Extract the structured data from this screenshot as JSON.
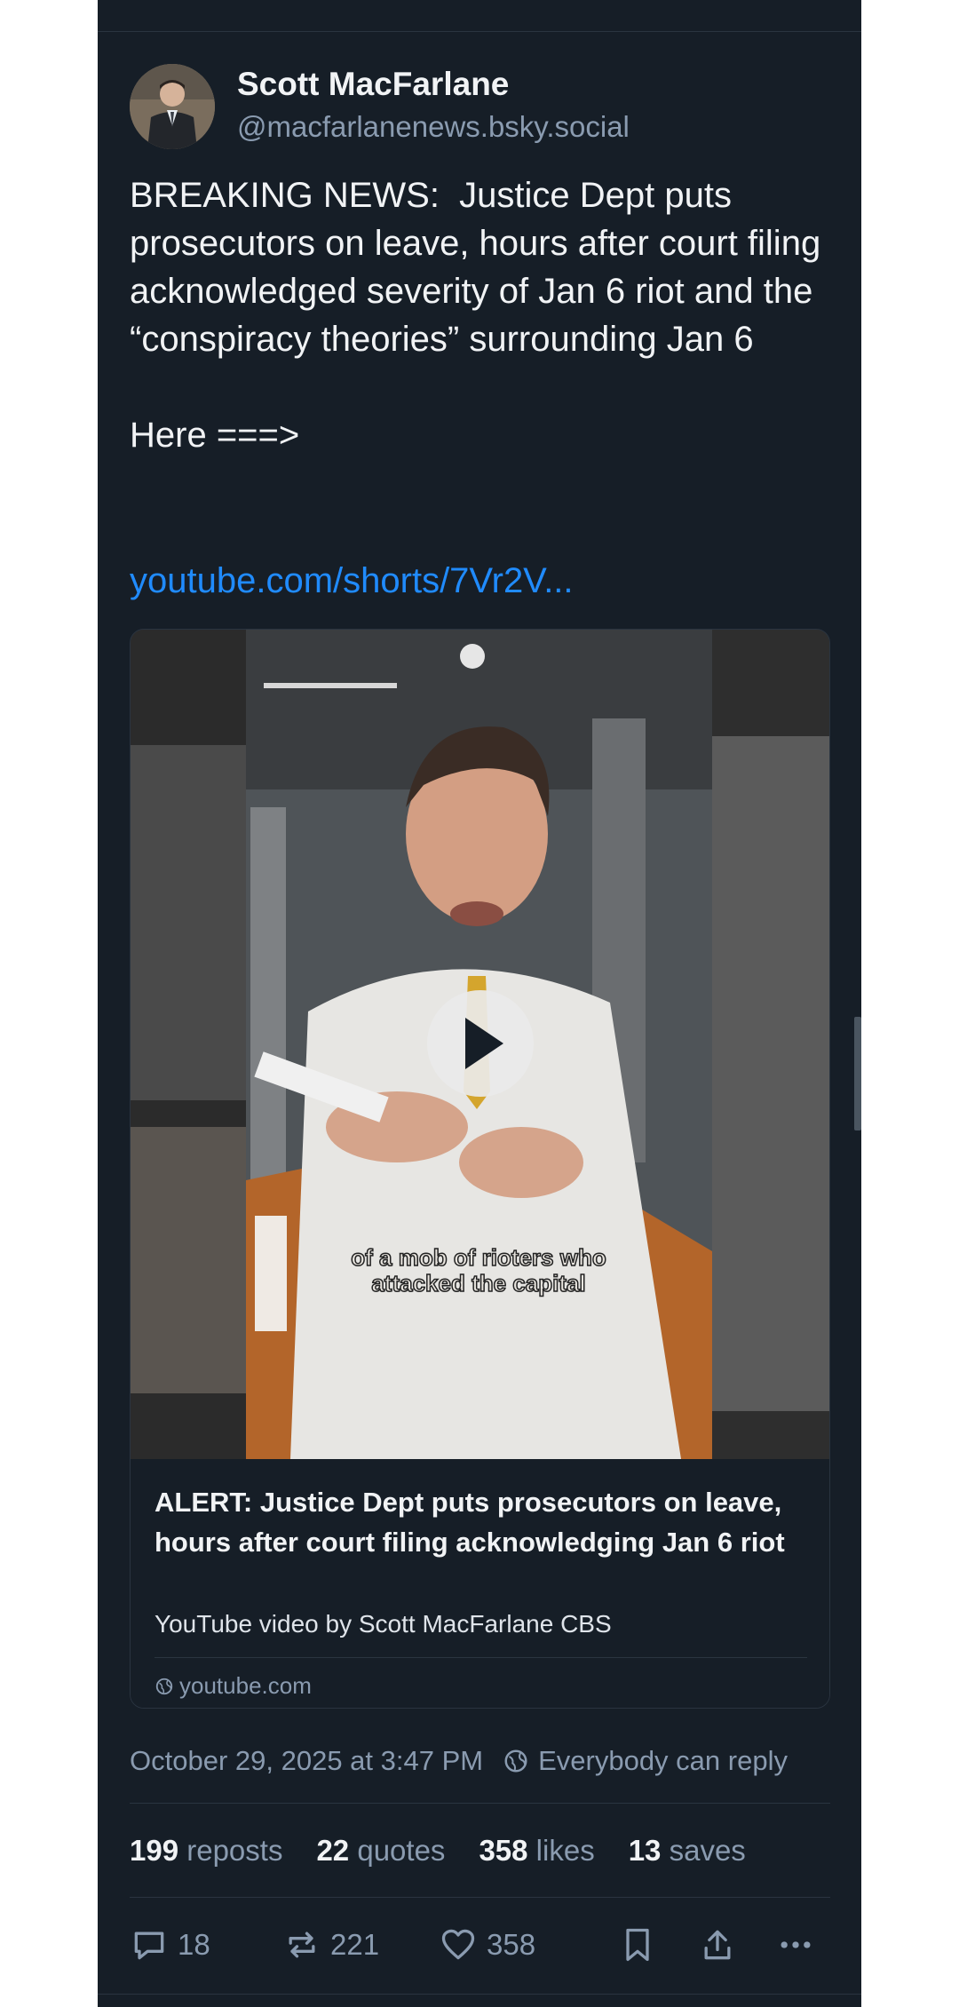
{
  "author": {
    "name": "Scott MacFarlane",
    "handle": "@macfarlanenews.bsky.social"
  },
  "post": {
    "text": "BREAKING NEWS:  Justice Dept puts prosecutors on leave, hours after court filing acknowledged severity of Jan 6 riot and the “conspiracy theories” surrounding Jan 6\n\nHere ===>",
    "link": "youtube.com/shorts/7Vr2V..."
  },
  "embed": {
    "caption_line1": "of a mob of rioters who",
    "caption_line2": "attacked the capital",
    "title": "ALERT:  Justice Dept puts prosecutors on leave, hours after court filing acknowledging Jan 6 riot",
    "description": "YouTube video by Scott MacFarlane CBS",
    "domain": "youtube.com"
  },
  "meta": {
    "timestamp": "October 29, 2025 at 3:47 PM",
    "reply_setting": "Everybody can reply"
  },
  "stats": {
    "reposts_count": "199",
    "reposts_label": "reposts",
    "quotes_count": "22",
    "quotes_label": "quotes",
    "likes_count": "358",
    "likes_label": "likes",
    "saves_count": "13",
    "saves_label": "saves"
  },
  "actions": {
    "reply_count": "18",
    "repost_count": "221",
    "like_count": "358"
  },
  "colors": {
    "background": "#161e27",
    "link": "#208bfe",
    "muted_text": "#8a9bb0",
    "primary_text": "#f1f3f5"
  }
}
